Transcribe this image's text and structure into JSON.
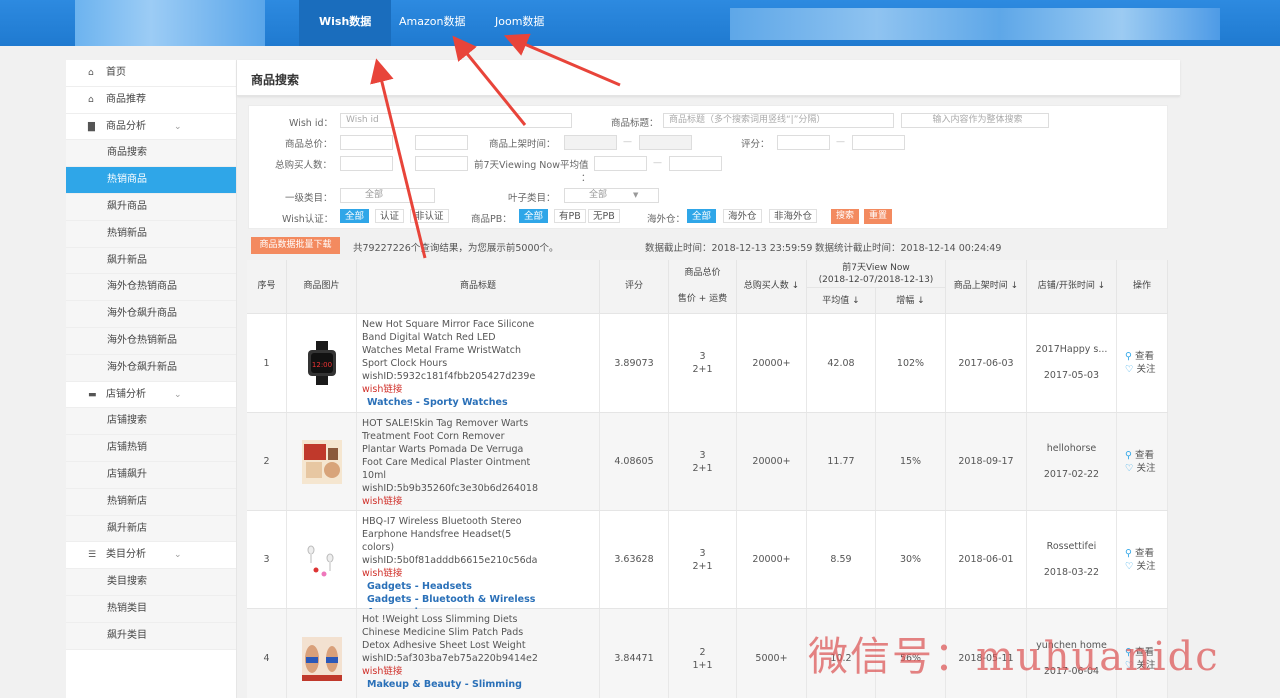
{
  "topnav": {
    "tabs": [
      {
        "label": "Wish数据",
        "active": true
      },
      {
        "label": "Amazon数据",
        "active": false
      },
      {
        "label": "Joom数据",
        "active": false
      }
    ]
  },
  "sidebar": {
    "items": [
      {
        "label": "首页",
        "icon": "home-icon",
        "type": "top"
      },
      {
        "label": "商品推荐",
        "icon": "home-icon",
        "type": "top"
      },
      {
        "label": "商品分析",
        "icon": "briefcase-icon",
        "type": "top",
        "expandable": true
      },
      {
        "label": "商品搜索",
        "type": "sub"
      },
      {
        "label": "热销商品",
        "type": "sub",
        "active": true
      },
      {
        "label": "飙升商品",
        "type": "sub"
      },
      {
        "label": "热销新品",
        "type": "sub"
      },
      {
        "label": "飙升新品",
        "type": "sub"
      },
      {
        "label": "海外仓热销商品",
        "type": "sub"
      },
      {
        "label": "海外仓飙升商品",
        "type": "sub"
      },
      {
        "label": "海外仓热销新品",
        "type": "sub"
      },
      {
        "label": "海外仓飙升新品",
        "type": "sub"
      },
      {
        "label": "店铺分析",
        "icon": "folder-icon",
        "type": "top",
        "expandable": true
      },
      {
        "label": "店铺搜索",
        "type": "sub"
      },
      {
        "label": "店铺热销",
        "type": "sub"
      },
      {
        "label": "店铺飙升",
        "type": "sub"
      },
      {
        "label": "热销新店",
        "type": "sub"
      },
      {
        "label": "飙升新店",
        "type": "sub"
      },
      {
        "label": "类目分析",
        "icon": "list-icon",
        "type": "top",
        "expandable": true
      },
      {
        "label": "类目搜索",
        "type": "sub"
      },
      {
        "label": "热销类目",
        "type": "sub"
      },
      {
        "label": "飙升类目",
        "type": "sub"
      }
    ]
  },
  "page": {
    "title": "商品搜索"
  },
  "search": {
    "wish_id_label": "Wish id：",
    "wish_id_placeholder": "Wish id",
    "title_label": "商品标题：",
    "title_placeholder": "商品标题（多个搜索词用竖线“|”分隔）",
    "overall_placeholder": "输入内容作为整体搜索",
    "total_price_label": "商品总价：",
    "listed_time_label": "商品上架时间：",
    "rating_label": "评分：",
    "buyers_label": "总购买人数：",
    "viewing_label": "前7天Viewing Now平均值",
    "viewing_label2": "：",
    "level1_label": "一级类目：",
    "level1_value": "全部",
    "leaf_label": "叶子类目：",
    "leaf_value": "全部",
    "wish_cert_label": "Wish认证：",
    "wish_cert_options": [
      "全部",
      "认证",
      "非认证"
    ],
    "pb_label": "商品PB：",
    "pb_options": [
      "全部",
      "有PB",
      "无PB"
    ],
    "overseas_label": "海外仓：",
    "overseas_options": [
      "全部",
      "海外仓",
      "非海外仓"
    ],
    "search_button": "搜索",
    "reset_button": "重置",
    "dash": "—"
  },
  "results": {
    "batch_download": "商品数据批量下载",
    "count_text": "共79227226个查询结果，为您展示前5000个。",
    "data_cutoff": "数据截止时间：2018-12-13 23:59:59",
    "stats_cutoff": "数据统计截止时间：2018-12-14 00:24:49"
  },
  "table": {
    "headers": {
      "index": "序号",
      "image": "商品图片",
      "title": "商品标题",
      "rating": "评分",
      "price_line1": "商品总价",
      "price_line2": "售价 + 运费",
      "buyers": "总购买人数 ↓",
      "viewnow_line1": "前7天View Now",
      "viewnow_line2": "(2018-12-07/2018-12-13)",
      "avg": "平均值 ↓",
      "growth": "增幅 ↓",
      "listed": "商品上架时间 ↓",
      "shop": "店铺/开张时间 ↓",
      "ops": "操作"
    },
    "rows": [
      {
        "index": "1",
        "title": "New Hot Square Mirror Face Silicone Band Digital Watch Red LED Watches Metal Frame WristWatch Sport Clock Hours",
        "wish_id": "wishID:5932c181f4fbb205427d239e",
        "link": "wish链接",
        "categories": [
          "Watches - Sporty Watches"
        ],
        "rating": "3.89073",
        "price_total": "3",
        "price_detail": "2+1",
        "buyers": "20000+",
        "avg": "42.08",
        "growth": "102%",
        "listed": "2017-06-03",
        "shop": "2017Happy s...",
        "shop_open": "2017-05-03",
        "view": "查看",
        "follow": "关注",
        "thumb": "watch"
      },
      {
        "index": "2",
        "title": "HOT SALE!Skin Tag Remover Warts Treatment Foot Corn Remover Plantar Warts Pomada De Verruga Foot Care Medical Plaster Ointment 10ml",
        "wish_id": "wishID:5b9b35260fc3e30b6d264018",
        "link": "wish链接",
        "categories": [],
        "rating": "4.08605",
        "price_total": "3",
        "price_detail": "2+1",
        "buyers": "20000+",
        "avg": "11.77",
        "growth": "15%",
        "listed": "2018-09-17",
        "shop": "hellohorse",
        "shop_open": "2017-02-22",
        "view": "查看",
        "follow": "关注",
        "thumb": "ointment"
      },
      {
        "index": "3",
        "title": "HBQ-I7 Wireless Bluetooth Stereo Earphone Handsfree Headset(5 colors)",
        "wish_id": "wishID:5b0f81adddb6615e210c56da",
        "link": "wish链接",
        "categories": [
          "Gadgets - Headsets",
          "Gadgets - Bluetooth & Wireless Accessories"
        ],
        "rating": "3.63628",
        "price_total": "3",
        "price_detail": "2+1",
        "buyers": "20000+",
        "avg": "8.59",
        "growth": "30%",
        "listed": "2018-06-01",
        "shop": "Rossettifei",
        "shop_open": "2018-03-22",
        "view": "查看",
        "follow": "关注",
        "thumb": "earphone"
      },
      {
        "index": "4",
        "title": "Hot !Weight Loss Slimming Diets Chinese Medicine Slim Patch Pads Detox Adhesive Sheet Lost Weight",
        "wish_id": "wishID:5af303ba7eb75a220b9414e2",
        "link": "wish链接",
        "categories": [
          "Makeup & Beauty - Slimming"
        ],
        "rating": "3.84471",
        "price_total": "2",
        "price_detail": "1+1",
        "buyers": "5000+",
        "avg": "10.2",
        "growth": "56%",
        "listed": "2018-05-11",
        "shop": "yunchen home",
        "shop_open": "2017-06-04",
        "view": "查看",
        "follow": "关注",
        "thumb": "slimming"
      }
    ]
  },
  "watermark": "微信号：muhuanidc"
}
